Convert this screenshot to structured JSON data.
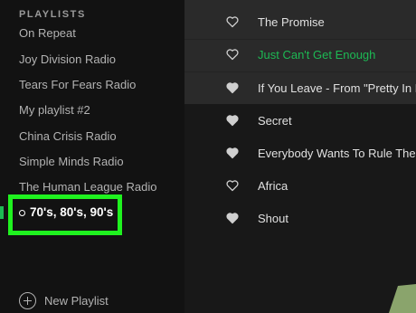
{
  "sidebar": {
    "section_title": "PLAYLISTS",
    "items": [
      {
        "label": "On Repeat"
      },
      {
        "label": "Joy Division Radio"
      },
      {
        "label": "Tears For Fears Radio"
      },
      {
        "label": "My playlist #2"
      },
      {
        "label": "China Crisis Radio"
      },
      {
        "label": "Simple Minds Radio"
      },
      {
        "label": "The Human League Radio"
      }
    ],
    "active_item": {
      "label": "70's, 80's, 90's"
    },
    "new_playlist_label": "New Playlist"
  },
  "tracks": [
    {
      "title": "The Promise",
      "liked": false,
      "playing": false
    },
    {
      "title": "Just Can't Get Enough",
      "liked": false,
      "playing": true
    },
    {
      "title": "If You Leave - From \"Pretty In Pink\"",
      "liked": true,
      "playing": false
    },
    {
      "title": "Secret",
      "liked": true,
      "playing": false
    },
    {
      "title": "Everybody Wants To Rule The World",
      "liked": true,
      "playing": false
    },
    {
      "title": "Africa",
      "liked": false,
      "playing": false
    },
    {
      "title": "Shout",
      "liked": true,
      "playing": false
    }
  ],
  "colors": {
    "accent": "#1db954",
    "highlight_box": "#1ff21f",
    "corner_shape": "#8aa46c"
  }
}
